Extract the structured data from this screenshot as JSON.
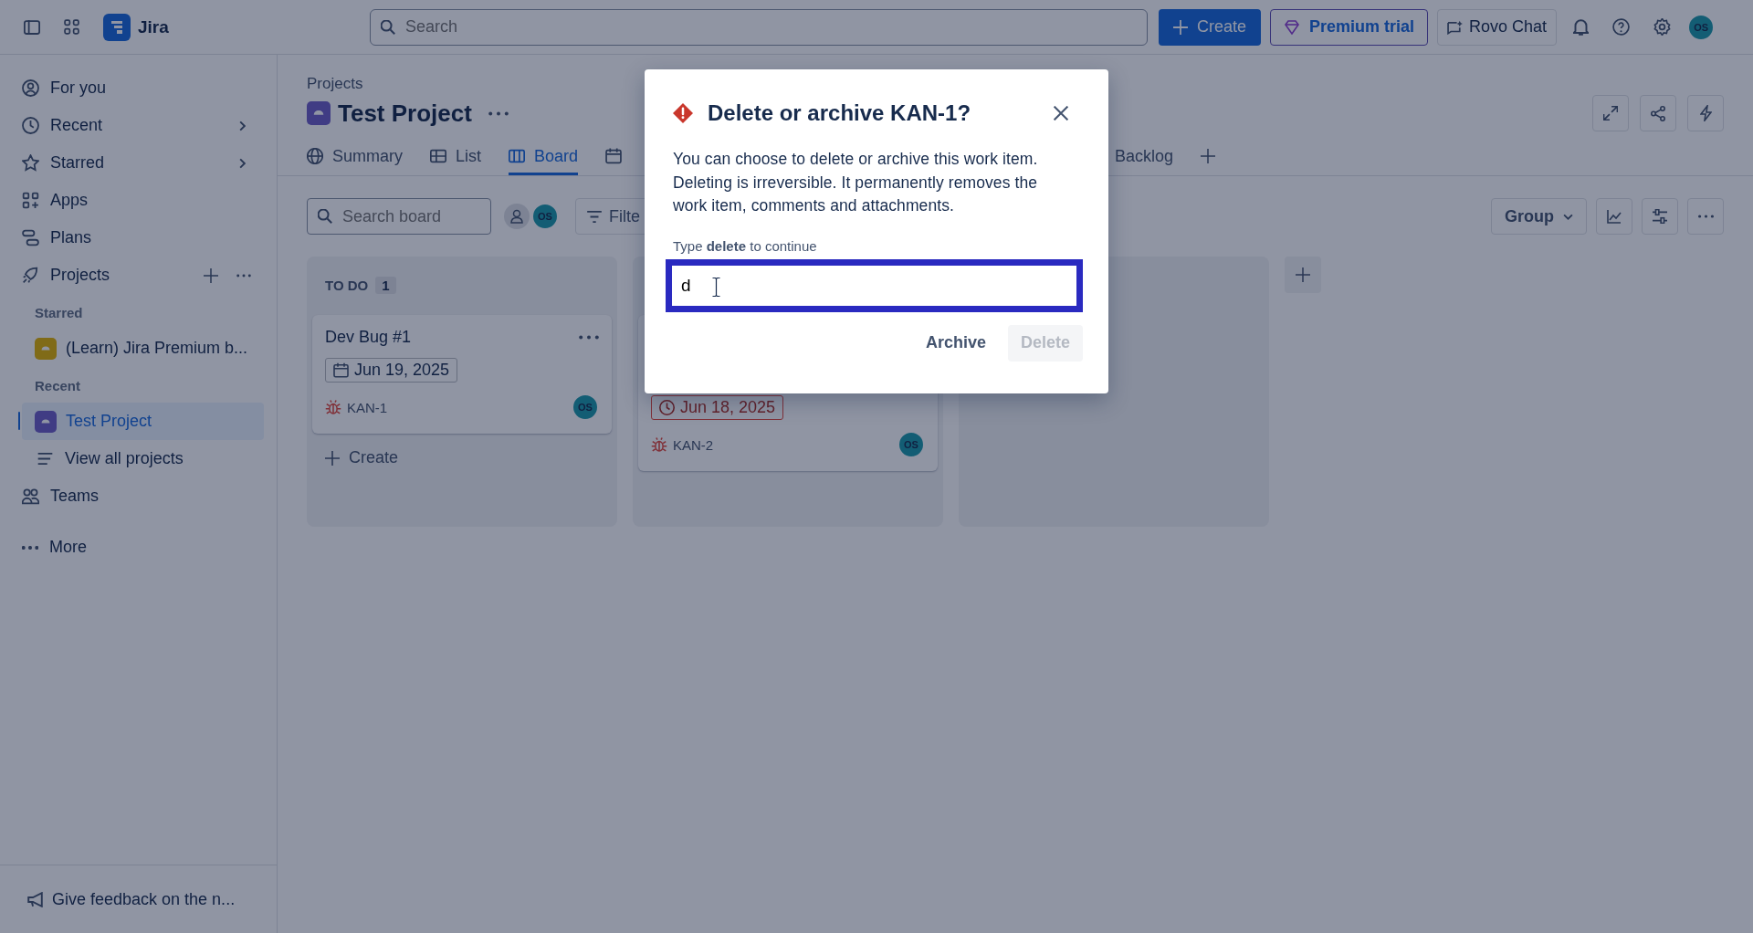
{
  "topbar": {
    "app_name": "Jira",
    "search": {
      "placeholder": "Search"
    },
    "create": "Create",
    "premium": "Premium trial",
    "rovo": "Rovo Chat",
    "avatar": "OS"
  },
  "sidebar": {
    "items": [
      {
        "kind": "nav",
        "label": "For you",
        "chevron": false,
        "selected": false
      },
      {
        "kind": "nav",
        "label": "Recent",
        "chevron": true,
        "selected": false
      },
      {
        "kind": "nav",
        "label": "Starred",
        "chevron": true,
        "selected": false
      },
      {
        "kind": "nav",
        "label": "Apps",
        "chevron": false,
        "selected": false
      },
      {
        "kind": "nav",
        "label": "Plans",
        "chevron": false,
        "selected": false
      },
      {
        "kind": "projects",
        "label": "Projects",
        "chevron": false,
        "selected": false
      },
      {
        "kind": "section",
        "label": "Starred"
      },
      {
        "kind": "project",
        "label": "(Learn) Jira Premium b...",
        "selected": false
      },
      {
        "kind": "section",
        "label": "Recent"
      },
      {
        "kind": "project",
        "label": "Test Project",
        "selected": true
      },
      {
        "kind": "sub",
        "label": "View all projects",
        "selected": false
      },
      {
        "kind": "nav",
        "label": "Teams",
        "chevron": false,
        "selected": false
      },
      {
        "kind": "more",
        "label": "More",
        "chevron": false,
        "selected": false
      }
    ],
    "feedback": "Give feedback on the n..."
  },
  "header": {
    "breadcrumb": "Projects",
    "title": "Test Project"
  },
  "tabs": [
    {
      "kind": "summary",
      "label": "Summary",
      "selected": false
    },
    {
      "kind": "list",
      "label": "List",
      "selected": false
    },
    {
      "kind": "board",
      "label": "Board",
      "selected": true
    },
    {
      "kind": "calendar",
      "selected": false
    },
    {
      "kind": "backlog",
      "label": "Backlog",
      "selected": false
    }
  ],
  "toolbar": {
    "search": {
      "placeholder": "Search board"
    },
    "avatar": "OS",
    "filter": "Filte",
    "group": "Group"
  },
  "columns": [
    {
      "title": "TO DO",
      "count": "1",
      "cards": [
        {
          "title": "Dev Bug #1",
          "date": "Jun 19, 2025",
          "overdue": false,
          "key": "KAN-1",
          "assignee": "OS"
        }
      ],
      "create": "Create"
    },
    {
      "cards": [
        {
          "date": "Jun 18, 2025",
          "overdue": true,
          "key": "KAN-2",
          "assignee": "OS"
        }
      ]
    },
    {}
  ],
  "dialog": {
    "title": "Delete or archive KAN-1?",
    "body": "You can choose to delete or archive this work item. Deleting is irreversible. It permanently removes the work item, comments and attachments.",
    "field_label": "Type **delete** to continue",
    "value": "d",
    "buttons": [
      {
        "label": "Archive",
        "disabled": false
      },
      {
        "label": "Delete",
        "disabled": true
      }
    ]
  }
}
